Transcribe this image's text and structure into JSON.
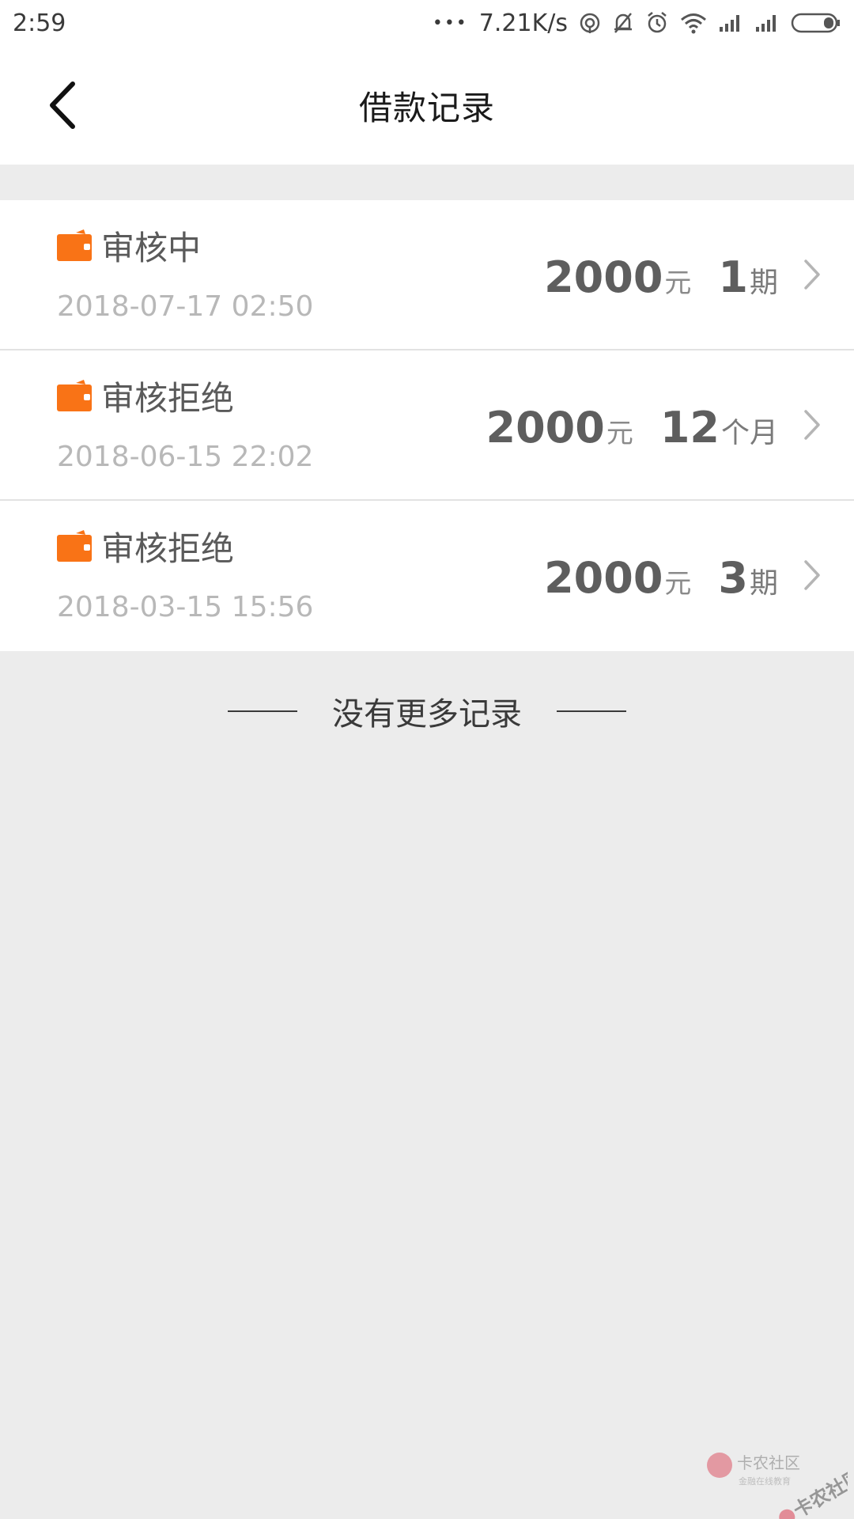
{
  "status_bar": {
    "time": "2:59",
    "dots": "•••",
    "network_speed": "7.21K/s",
    "icons": [
      "hotspot-icon",
      "bell-off-icon",
      "alarm-icon",
      "wifi-icon",
      "signal-icon",
      "signal-icon",
      "battery-icon"
    ]
  },
  "header": {
    "title": "借款记录"
  },
  "records": [
    {
      "status": "审核中",
      "date": "2018-07-17 02:50",
      "amount": "2000",
      "amount_unit": "元",
      "term": "1",
      "term_unit": "期"
    },
    {
      "status": "审核拒绝",
      "date": "2018-06-15 22:02",
      "amount": "2000",
      "amount_unit": "元",
      "term": "12",
      "term_unit": "个月"
    },
    {
      "status": "审核拒绝",
      "date": "2018-03-15 15:56",
      "amount": "2000",
      "amount_unit": "元",
      "term": "3",
      "term_unit": "期"
    }
  ],
  "footer": {
    "no_more_text": "没有更多记录"
  },
  "watermark": {
    "brand": "卡农社区",
    "tagline": "金融在线教育"
  },
  "colors": {
    "accent_orange": "#f97316",
    "background": "#ececec",
    "card": "#ffffff"
  }
}
